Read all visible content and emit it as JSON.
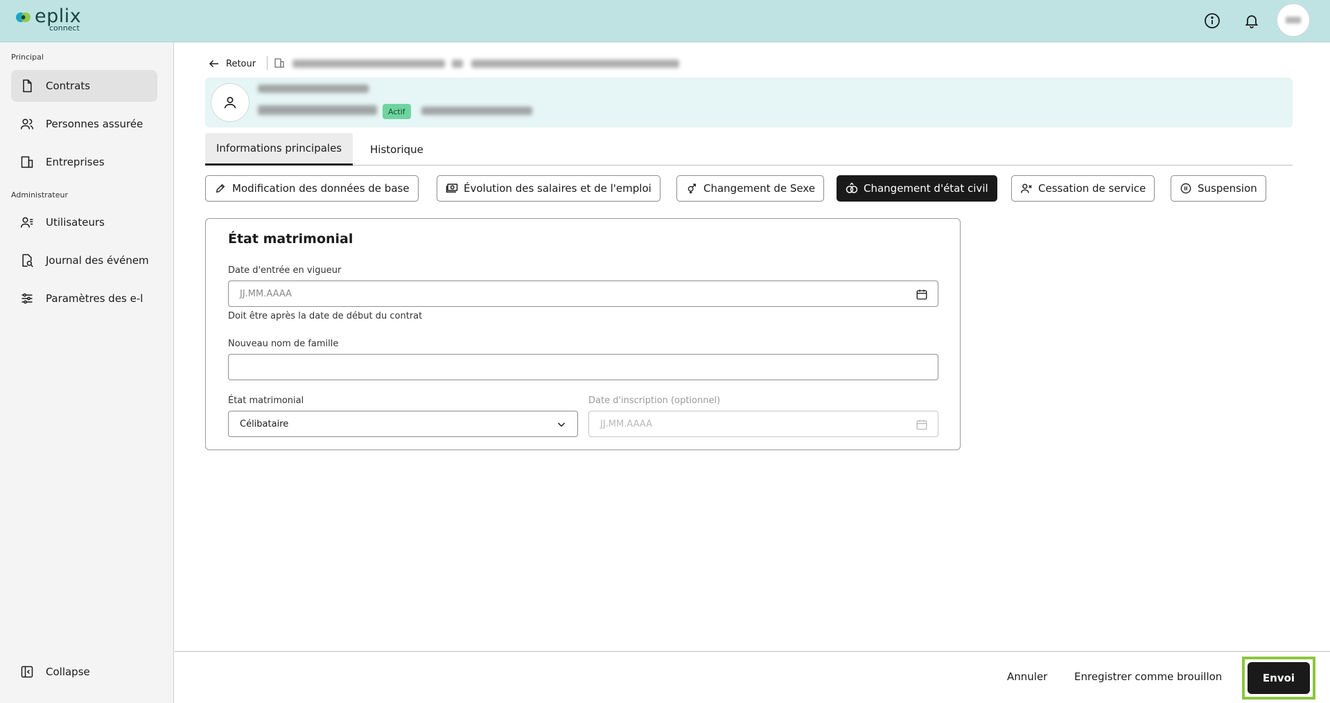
{
  "app": {
    "logo_text": "eplix",
    "logo_sub": "connect"
  },
  "topbar": {
    "info_icon": "info-icon",
    "bell_icon": "bell-icon",
    "avatar": "user-avatar"
  },
  "sidebar": {
    "section_principal": "Principal",
    "section_admin": "Administrateur",
    "items": [
      {
        "label": "Contrats",
        "icon": "document-icon",
        "active": true
      },
      {
        "label": "Personnes assurée",
        "icon": "people-icon",
        "active": false
      },
      {
        "label": "Entreprises",
        "icon": "building-icon",
        "active": false
      },
      {
        "label": "Utilisateurs",
        "icon": "users-icon",
        "active": false
      },
      {
        "label": "Journal des événem",
        "icon": "journal-icon",
        "active": false
      },
      {
        "label": "Paramètres des e-l",
        "icon": "sliders-icon",
        "active": false
      }
    ],
    "collapse_label": "Collapse"
  },
  "header": {
    "back_label": "Retour",
    "status_badge": "Actif"
  },
  "tabs": [
    {
      "label": "Informations principales",
      "active": true
    },
    {
      "label": "Historique",
      "active": false
    }
  ],
  "actions": [
    {
      "label": "Modification des données de base",
      "icon": "pencil-icon"
    },
    {
      "label": "Évolution des salaires et de l'emploi",
      "icon": "money-icon"
    },
    {
      "label": "Changement de Sexe",
      "icon": "gender-icon"
    },
    {
      "label": "Changement d'état civil",
      "icon": "rings-icon",
      "selected": true
    },
    {
      "label": "Cessation de service",
      "icon": "user-remove-icon"
    },
    {
      "label": "Suspension",
      "icon": "pause-icon"
    }
  ],
  "form": {
    "title": "État matrimonial",
    "date_entry_label": "Date d'entrée en vigueur",
    "date_entry_placeholder": "JJ.MM.AAAA",
    "date_entry_helper": "Doit être après la date de début du contrat",
    "last_name_label": "Nouveau nom de famille",
    "last_name_value": "",
    "civil_status_label": "État matrimonial",
    "civil_status_value": "Célibataire",
    "registration_date_label": "Date d'inscription (optionnel)",
    "registration_date_placeholder": "JJ.MM.AAAA"
  },
  "footer": {
    "cancel_label": "Annuler",
    "draft_label": "Enregistrer comme brouillon",
    "send_label": "Envoi"
  },
  "colors": {
    "topbar": "#bfe3e3",
    "accent_highlight": "#8dc63f",
    "badge": "#6fd3a0",
    "dark_button": "#1a1a1a"
  }
}
